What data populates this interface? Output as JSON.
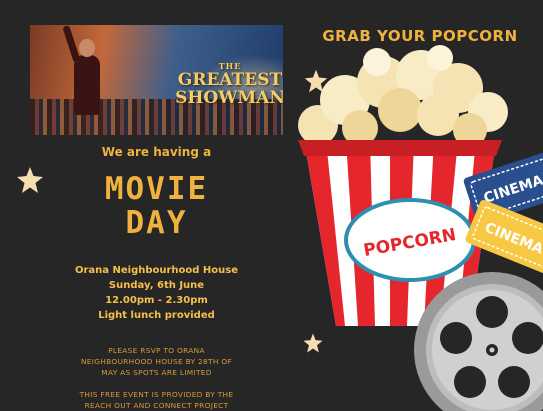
{
  "poster": {
    "title_small": "THE",
    "title_large_1": "GREATEST",
    "title_large_2": "SHOWMAN"
  },
  "headline": "GRAB YOUR POPCORN",
  "intro": "We are having a",
  "title_line1": "MOVIE",
  "title_line2": "DAY",
  "details": [
    "Orana Neighbourhood House",
    "Sunday, 6th June",
    "12.00pm - 2.30pm",
    "Light lunch provided"
  ],
  "rsvp": [
    "PLEASE RSVP TO ORANA",
    "NEIGHBOURHOOD HOUSE BY 28TH OF",
    "MAY AS SPOTS ARE LIMITED"
  ],
  "free_event": [
    "THIS FREE EVENT IS PROVIDED BY THE",
    "REACH OUT AND CONNECT PROJECT"
  ],
  "popcorn_box_label": "POPCORN",
  "ticket_labels": [
    "CINEMA",
    "CINEMA"
  ],
  "icons": [
    "star-icon",
    "popcorn-box-icon",
    "ticket-icon",
    "film-reel-icon"
  ],
  "colors": {
    "background": "#262626",
    "accent_gold": "#f0b23e",
    "popcorn_red": "#e5262c",
    "ticket_blue": "#2a4f8e",
    "ticket_yellow": "#f7c844",
    "reel_grey": "#9a9a9a"
  }
}
